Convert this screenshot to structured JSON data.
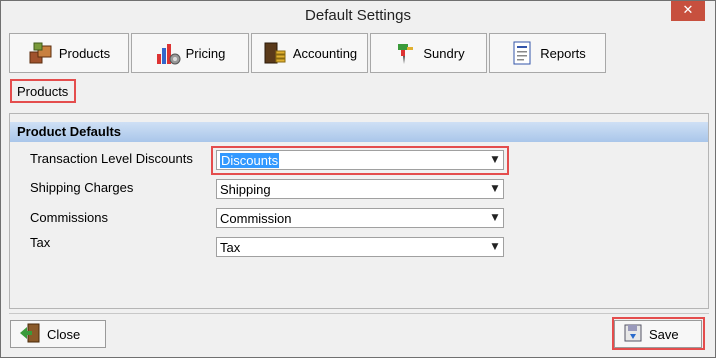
{
  "window": {
    "title": "Default Settings",
    "close_glyph": "✕"
  },
  "tabs": [
    {
      "label": "Products",
      "icon": "products-boxes-icon"
    },
    {
      "label": "Pricing",
      "icon": "pricing-chart-icon"
    },
    {
      "label": "Accounting",
      "icon": "accounting-coins-icon"
    },
    {
      "label": "Sundry",
      "icon": "sundry-pin-icon"
    },
    {
      "label": "Reports",
      "icon": "reports-document-icon"
    }
  ],
  "breadcrumb": {
    "label": "Products"
  },
  "section": {
    "title": "Product Defaults",
    "fields": [
      {
        "label": "Transaction Level Discounts",
        "value": "Discounts"
      },
      {
        "label": "Shipping Charges",
        "value": "Shipping"
      },
      {
        "label": "Commissions",
        "value": "Commission"
      },
      {
        "label": "Tax",
        "value": "Tax"
      }
    ]
  },
  "buttons": {
    "close_label": "Close",
    "save_label": "Save"
  },
  "colors": {
    "highlight_outline": "#e44d4d",
    "section_header": "#a9c6ea",
    "selection": "#3399ff",
    "title_close_button": "#c7503e"
  }
}
